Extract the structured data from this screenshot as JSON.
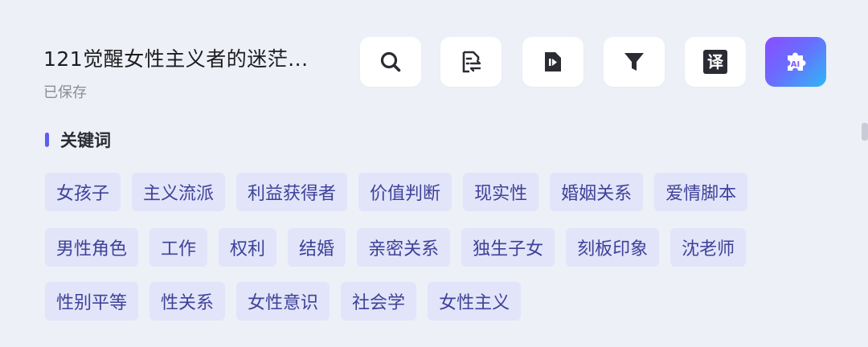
{
  "document": {
    "title": "121觉醒女性主义者的迷茫...",
    "status": "已保存"
  },
  "toolbar": {
    "buttons": [
      {
        "icon": "search-icon"
      },
      {
        "icon": "document-convert-icon"
      },
      {
        "icon": "play-document-icon"
      },
      {
        "icon": "filter-icon"
      },
      {
        "icon": "translate-icon",
        "glyph": "译"
      },
      {
        "icon": "ai-plugin-icon",
        "glyph": "AI"
      }
    ]
  },
  "keywords": {
    "section_label": "关键词",
    "rows": [
      [
        "女孩子",
        "主义流派",
        "利益获得者",
        "价值判断",
        "现实性",
        "婚姻关系",
        "爱情脚本"
      ],
      [
        "男性角色",
        "工作",
        "权利",
        "结婚",
        "亲密关系",
        "独生子女",
        "刻板印象",
        "沈老师"
      ],
      [
        "性别平等",
        "性关系",
        "女性意识",
        "社会学",
        "女性主义"
      ]
    ]
  },
  "colors": {
    "accent": "#5b5ff0",
    "tag_background": "#e2e4f9",
    "tag_text": "#3e4298",
    "page_background": "#eef0f8"
  }
}
